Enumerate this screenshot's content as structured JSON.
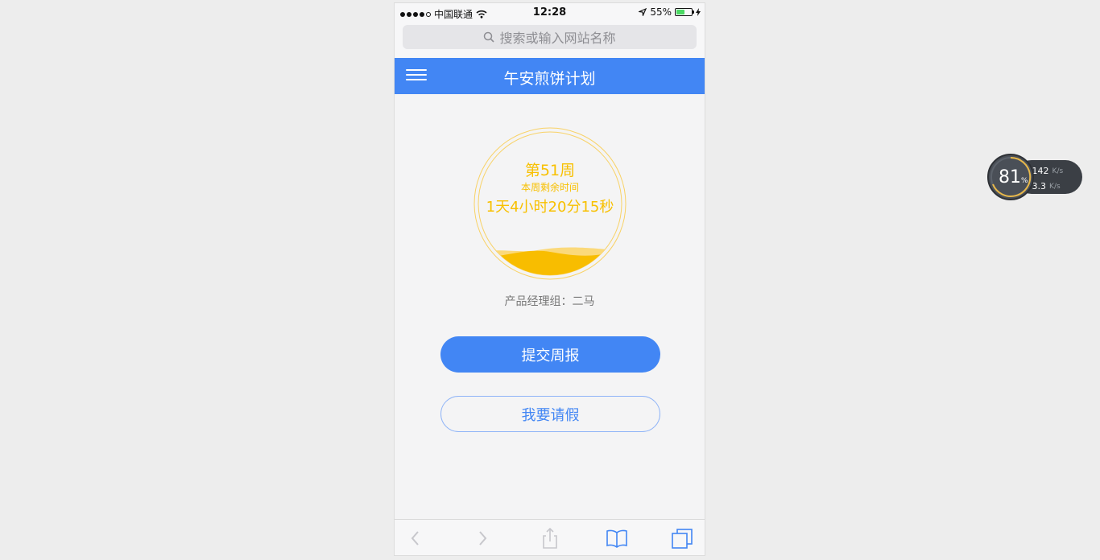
{
  "status_bar": {
    "carrier": "中国联通",
    "time": "12:28",
    "battery": "55%",
    "battery_level": 0.55
  },
  "url_bar": {
    "placeholder": "搜索或输入网站名称"
  },
  "header": {
    "title": "午安煎饼计划"
  },
  "main": {
    "week_label": "第51周",
    "remaining_label": "本周剩余时间",
    "countdown": "1天4小时20分15秒",
    "team": "产品经理组：二马",
    "submit_label": "提交周报",
    "leave_label": "我要请假"
  },
  "toolbar": {
    "items": [
      "back-icon",
      "forward-icon",
      "share-icon",
      "bookmarks-icon",
      "tabs-icon"
    ]
  },
  "monitor": {
    "cpu_value": "81",
    "cpu_unit": "%",
    "upload_value": "142",
    "upload_unit": "K/s",
    "download_value": "3.3",
    "download_unit": "K/s"
  },
  "colors": {
    "accent": "#4286f4",
    "gold": "#f8c000",
    "background": "#ededed"
  }
}
